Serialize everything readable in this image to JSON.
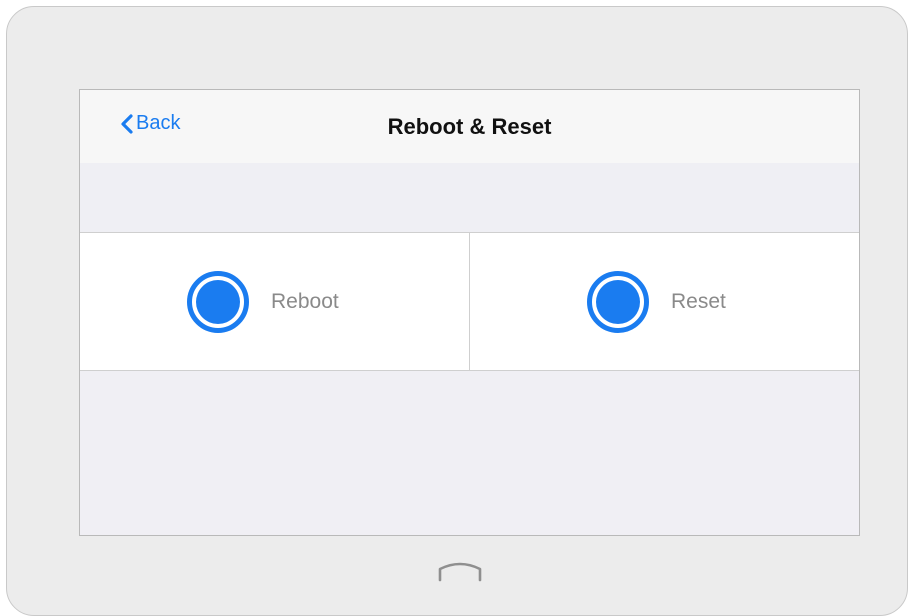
{
  "navbar": {
    "back_label": "Back",
    "title": "Reboot & Reset"
  },
  "options": [
    {
      "label": "Reboot",
      "selected": true
    },
    {
      "label": "Reset",
      "selected": true
    }
  ],
  "colors": {
    "accent": "#1a7cf0",
    "device_frame": "#ececec",
    "screen_background": "#f0eff4",
    "option_label": "#8a8a8a"
  },
  "icons": {
    "back": "chevron-left-icon",
    "home": "home-button-icon"
  }
}
